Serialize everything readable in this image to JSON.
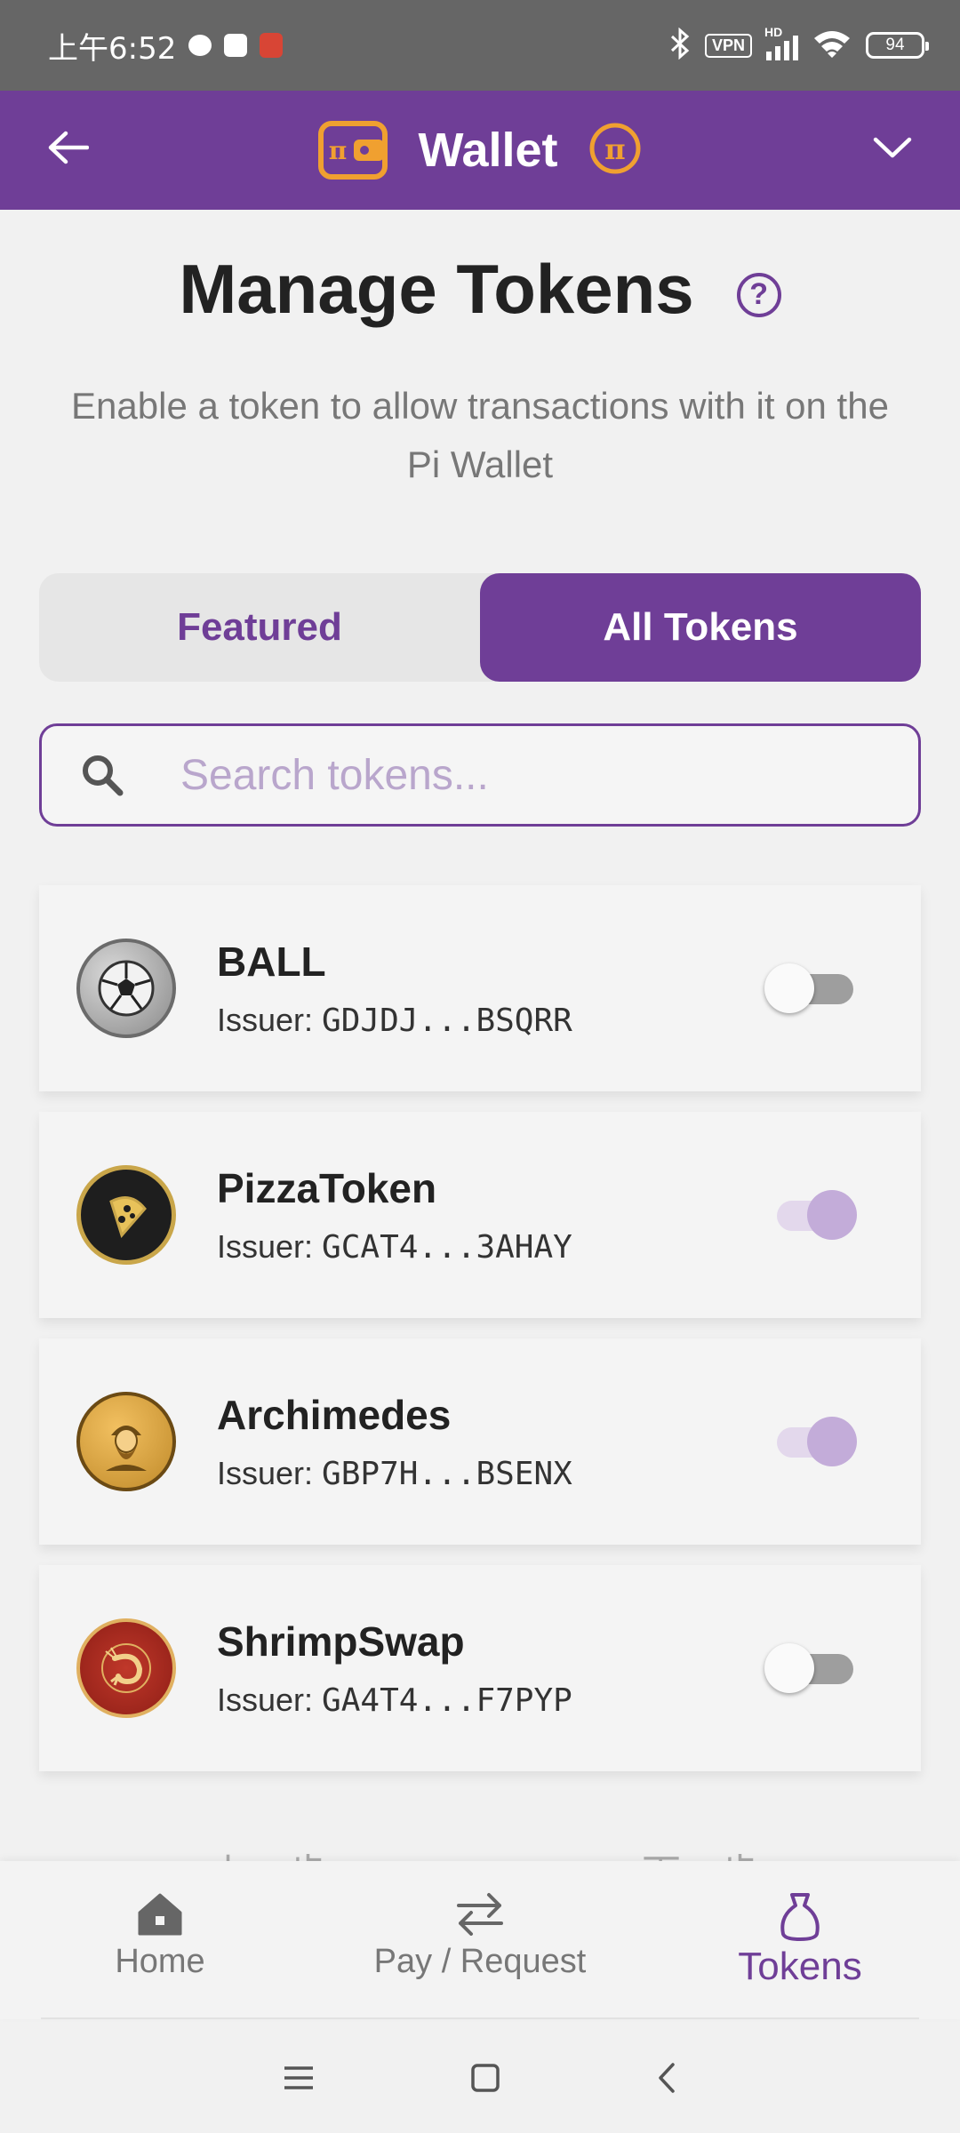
{
  "status_bar": {
    "time": "上午6:52",
    "vpn": "VPN",
    "network": "HD",
    "battery": "94"
  },
  "header": {
    "title": "Wallet"
  },
  "page": {
    "title": "Manage Tokens",
    "subtitle": "Enable a token to allow transactions with it on the Pi Wallet"
  },
  "tabs": {
    "featured": "Featured",
    "all": "All Tokens"
  },
  "search": {
    "placeholder": "Search tokens..."
  },
  "issuer_label": "Issuer: ",
  "tokens": [
    {
      "name": "BALL",
      "issuer": "GDJDJ...BSQRR",
      "enabled": false,
      "icon": "soccer-ball-icon"
    },
    {
      "name": "PizzaToken",
      "issuer": "GCAT4...3AHAY",
      "enabled": true,
      "icon": "pizza-icon"
    },
    {
      "name": "Archimedes",
      "issuer": "GBP7H...BSENX",
      "enabled": true,
      "icon": "archimedes-portrait-icon"
    },
    {
      "name": "ShrimpSwap",
      "issuer": "GA4T4...F7PYP",
      "enabled": false,
      "icon": "shrimp-icon"
    }
  ],
  "pager": {
    "prev": "上一步",
    "next": "下一步"
  },
  "bottom_nav": {
    "home": "Home",
    "pay": "Pay / Request",
    "tokens": "Tokens"
  },
  "colors": {
    "brand_purple": "#6f3e97",
    "pi_gold": "#f0a030",
    "status_bar": "#666666"
  }
}
